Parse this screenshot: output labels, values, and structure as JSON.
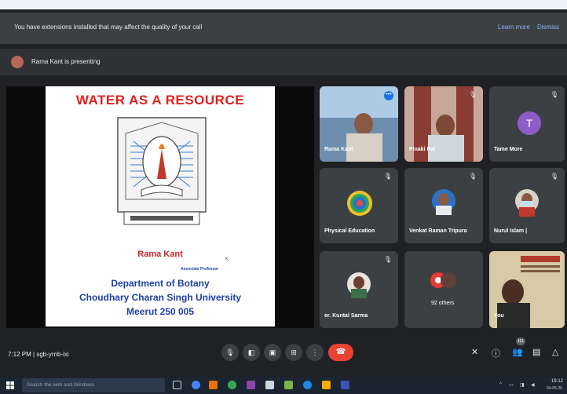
{
  "banner": {
    "text": "You have extensions installed that may affect the quality of your call",
    "learn_more": "Learn more",
    "dismiss": "Dismiss"
  },
  "presenting": {
    "text": "Rama Kant is presenting"
  },
  "slide": {
    "title": "WATER AS A RESOURCE",
    "name": "Rama Kant",
    "role": "Associate Professor",
    "department": "Department of Botany",
    "university": "Choudhary Charan Singh University",
    "city": "Meerut 250 005"
  },
  "participants": [
    {
      "name": "Rama Kant"
    },
    {
      "name": "Pinaki Pal"
    },
    {
      "name": "Tame More",
      "initial": "T"
    },
    {
      "name": "Physical Education"
    },
    {
      "name": "Venkat Raman Tripura"
    },
    {
      "name": "Nurul Islam |"
    },
    {
      "name": "er. Kuntal Sarma"
    },
    {
      "name": "92 others"
    },
    {
      "name": "You"
    }
  ],
  "controls": {
    "time_code": "7:12 PM  |  sgb-yrnb-ixi",
    "badge": "101",
    "end_icon": "phone-hangup-icon"
  },
  "taskbar": {
    "search_placeholder": "Search the web and Windows",
    "clock_time": "19:12",
    "clock_date": "04-05-20"
  },
  "colors": {
    "meet_background": "#202124",
    "end_call": "#ea4335",
    "accent": "#8ab4f8",
    "slide_title": "#e02020",
    "slide_text": "#1f3fa8"
  }
}
